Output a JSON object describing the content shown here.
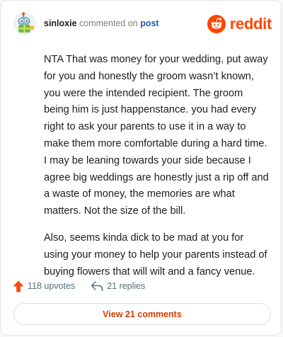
{
  "comment": {
    "username": "sinloxie",
    "action_text": "commented on",
    "post_link": "post",
    "paragraphs": [
      "NTA That was money for your wedding, put away for you and honestly the groom wasn’t known, you were the intended recipient. The groom being him is just happenstance. you had every right to ask your parents to use it in a way to make them more comfortable during a hard time. I may be leaning towards your side because I agree big weddings are honestly just a rip off and a waste of money, the memories are what matters. Not the size of the bill.",
      "Also, seems kinda dick to be mad at you for using your money to help your parents instead of buying flowers that will wilt and a fancy venue."
    ]
  },
  "brand": {
    "name": "reddit",
    "color": "#ff4500"
  },
  "footer": {
    "upvotes": "118 upvotes",
    "replies": "21 replies",
    "view_button": "View 21 comments",
    "upvote_color": "#ff4500"
  },
  "icons": [
    "avatar",
    "reddit-logo-icon",
    "upvote-arrow-icon",
    "reply-arrow-icon"
  ]
}
